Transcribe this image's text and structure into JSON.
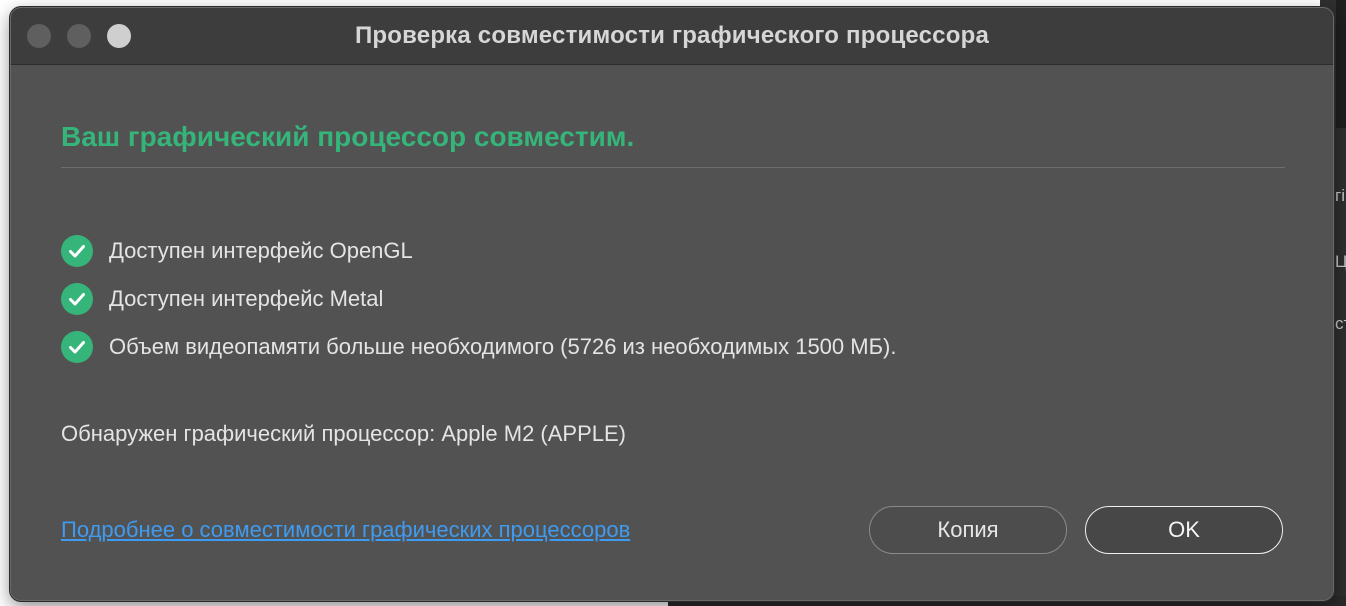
{
  "window": {
    "title": "Проверка совместимости графического процессора"
  },
  "dialog": {
    "headline": "Ваш графический процессор совместим.",
    "checks": [
      {
        "label": "Доступен интерфейс OpenGL",
        "icon": "check-circle-icon"
      },
      {
        "label": "Доступен интерфейс Metal",
        "icon": "check-circle-icon"
      },
      {
        "label": "Объем видеопамяти больше необходимого (5726 из необходимых 1500 МБ).",
        "icon": "check-circle-icon"
      }
    ],
    "gpu_detected": "Обнаружен графический процессор: Apple M2 (APPLE)",
    "link_text": "Подробнее о совместимости графических процессоров",
    "copy_label": "Копия",
    "ok_label": "OK"
  },
  "background_fragments": [
    "гі",
    "Цс",
    "ст"
  ],
  "colors": {
    "accent_green": "#35b57a",
    "link_blue": "#3f9bf0",
    "dialog_bg": "#525252",
    "titlebar_bg": "#3d3d3d"
  }
}
